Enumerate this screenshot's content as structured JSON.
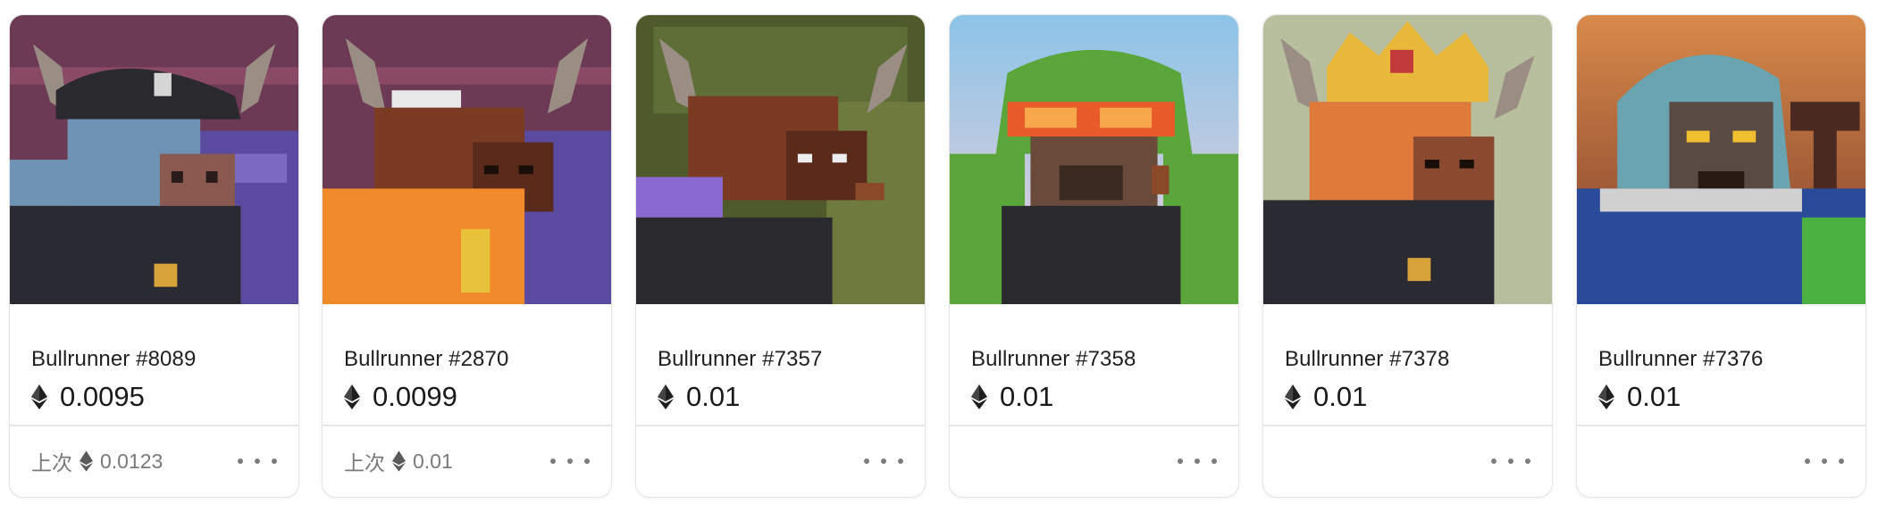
{
  "cards": [
    {
      "name": "Bullrunner #8089",
      "price": "0.0095",
      "last_label": "上次",
      "last_price": "0.0123",
      "bg": "#6e3a55",
      "fur": "#6f93b4",
      "art": "bull-blue-pirate-hat"
    },
    {
      "name": "Bullrunner #2870",
      "price": "0.0099",
      "last_label": "上次",
      "last_price": "0.01",
      "bg": "#6e3a55",
      "fur": "#7a3b22",
      "art": "bull-brown-orange-hoodie"
    },
    {
      "name": "Bullrunner #7357",
      "price": "0.01",
      "last_label": "",
      "last_price": "",
      "bg": "#4f5e2e",
      "fur": "#7a3b22",
      "art": "bull-brown-purple-hood"
    },
    {
      "name": "Bullrunner #7358",
      "price": "0.01",
      "last_label": "",
      "last_price": "",
      "bg": "#9fcbe6",
      "fur": "#6a4a3a",
      "art": "bear-green-helmet"
    },
    {
      "name": "Bullrunner #7378",
      "price": "0.01",
      "last_label": "",
      "last_price": "",
      "bg": "#b8bf9e",
      "fur": "#e07a3a",
      "art": "bull-orange-crown"
    },
    {
      "name": "Bullrunner #7376",
      "price": "0.01",
      "last_label": "",
      "last_price": "",
      "bg": "#d88a4a",
      "fur": "#5a4a44",
      "art": "gorilla-blue-hood"
    }
  ],
  "icons": {
    "currency": "ethereum-icon",
    "more": "more-options-icon"
  }
}
